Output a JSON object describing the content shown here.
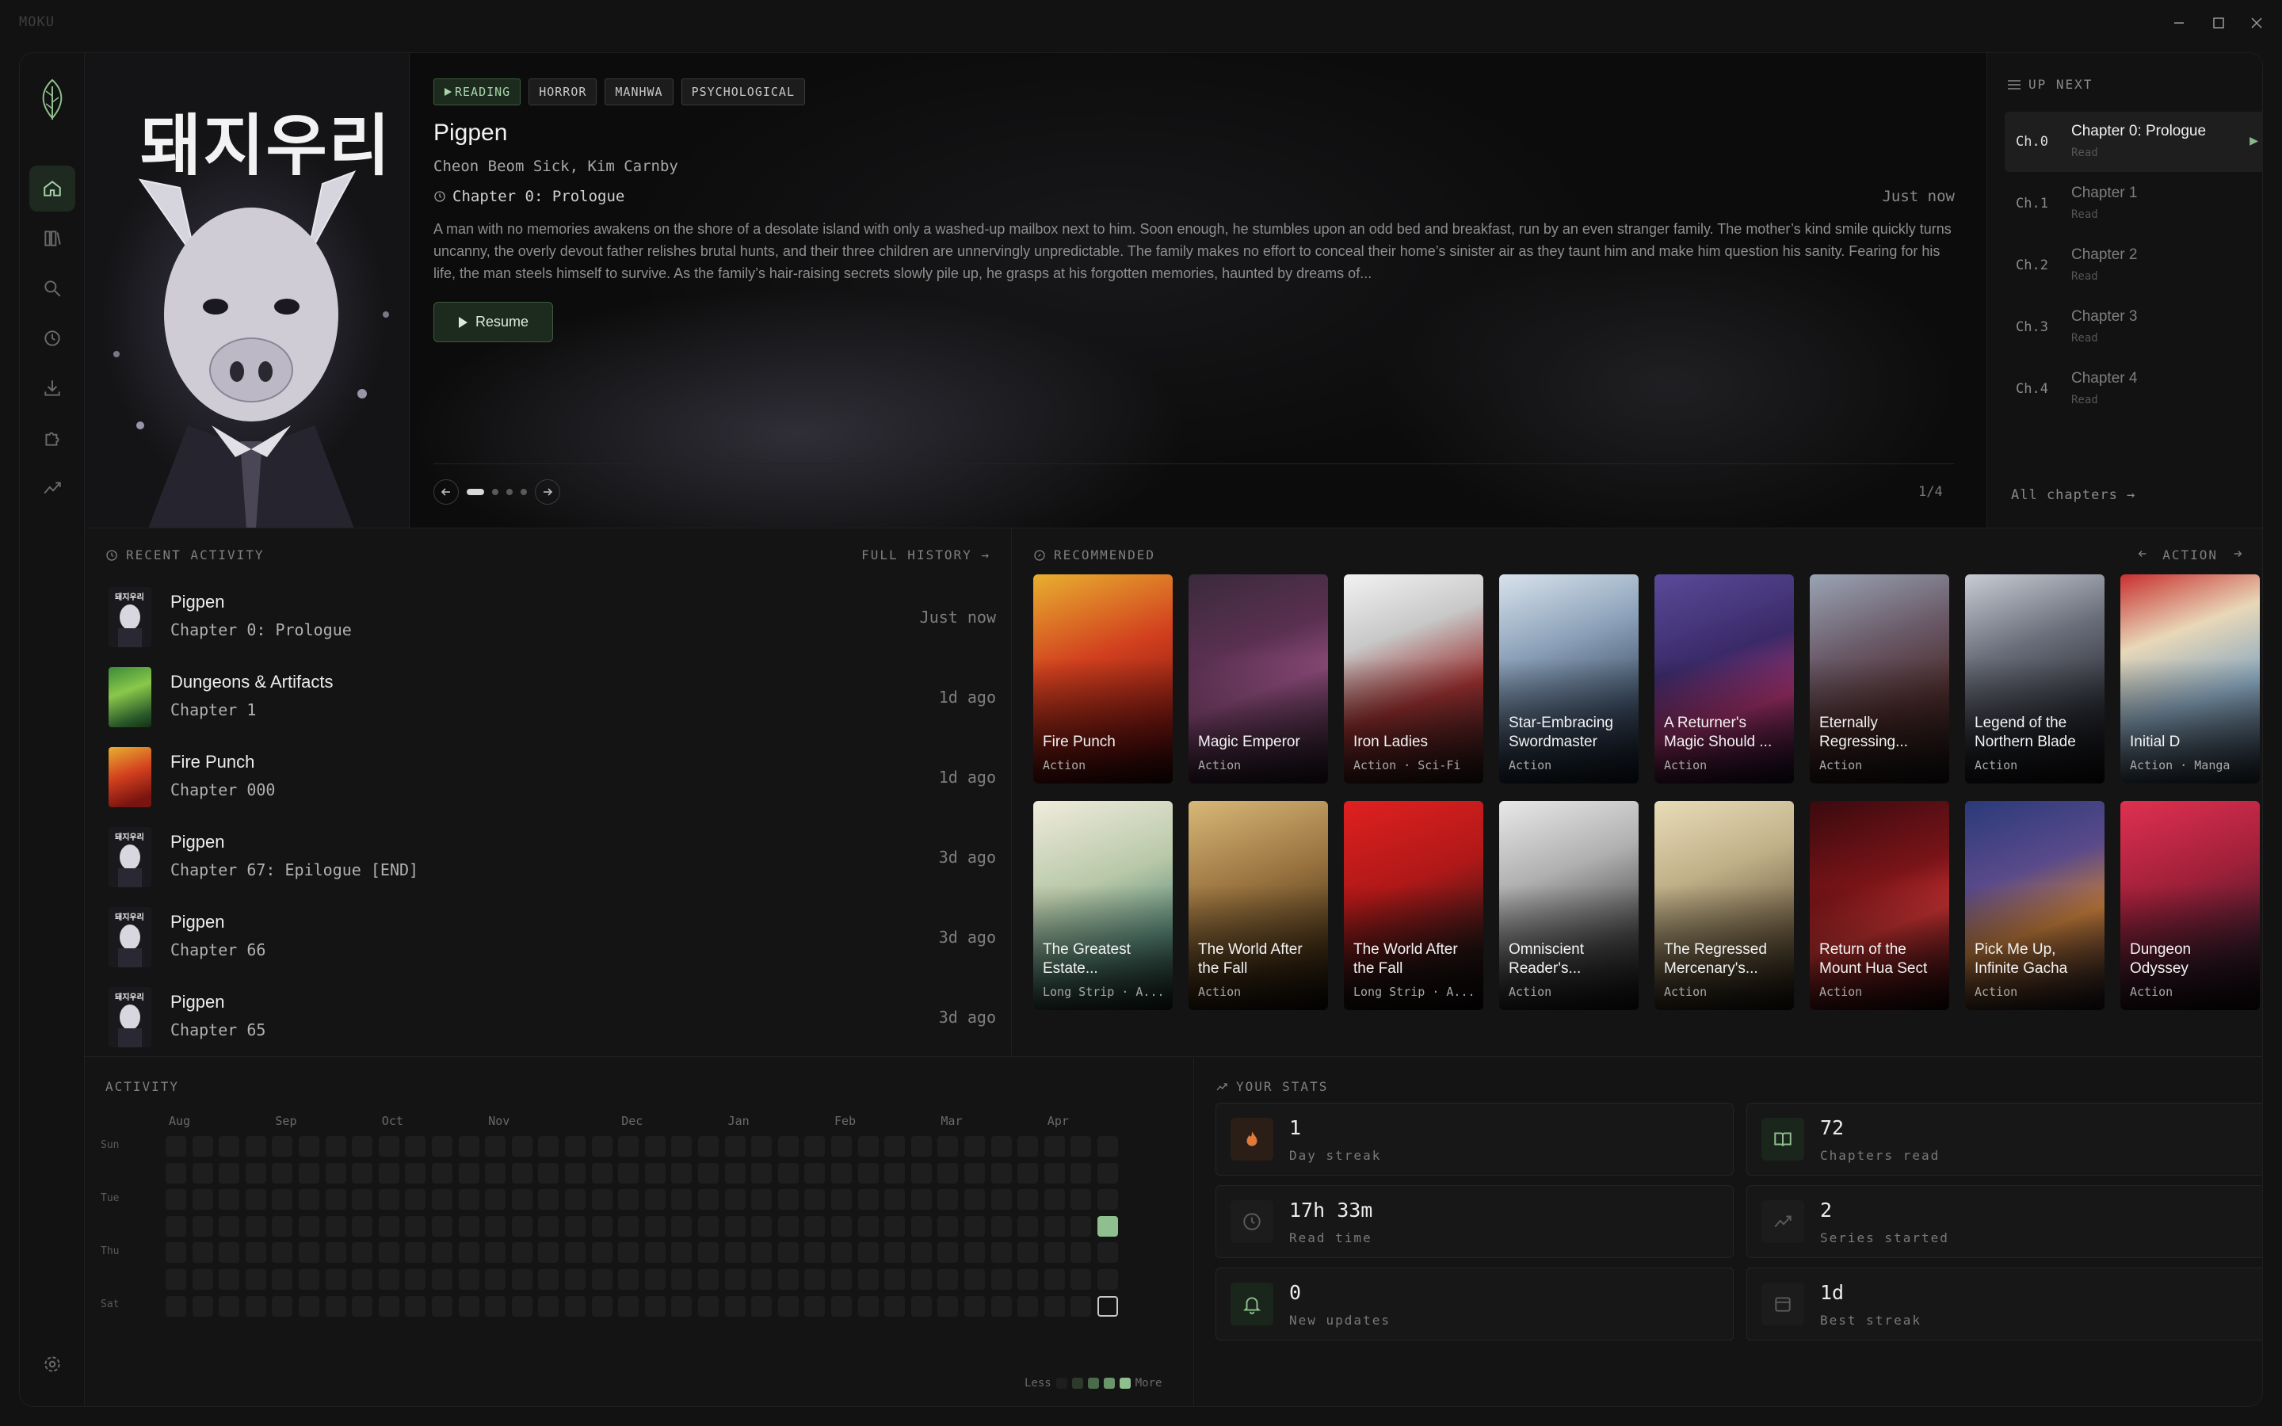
{
  "window": {
    "title": "MOKU"
  },
  "colors": {
    "accent": "#8fbf8f",
    "background": "#141414",
    "panel": "#121212"
  },
  "sidebar": {
    "items": [
      {
        "name": "home",
        "icon": "home-icon",
        "active": true
      },
      {
        "name": "library",
        "icon": "library-icon",
        "active": false
      },
      {
        "name": "search",
        "icon": "search-icon",
        "active": false
      },
      {
        "name": "history",
        "icon": "history-icon",
        "active": false
      },
      {
        "name": "downloads",
        "icon": "download-icon",
        "active": false
      },
      {
        "name": "extensions",
        "icon": "puzzle-icon",
        "active": false
      },
      {
        "name": "stats",
        "icon": "chart-icon",
        "active": false
      }
    ],
    "bottom": {
      "icon": "gear-icon"
    }
  },
  "hero": {
    "tags": [
      "READING",
      "HORROR",
      "MANHWA",
      "PSYCHOLOGICAL"
    ],
    "title": "Pigpen",
    "cover_text": "돼지우리",
    "authors": "Cheon Beom Sick, Kim Carnby",
    "chapter": "Chapter 0: Prologue",
    "timestamp": "Just now",
    "description": "A man with no memories awakens on the shore of a desolate island with only a washed-up mailbox next to him. Soon enough, he stumbles upon an odd bed and breakfast, run by an even stranger family. The mother’s kind smile quickly turns uncanny, the overly devout father relishes brutal hunts, and their three children are unnervingly unpredictable. The family makes no effort to conceal their home’s sinister air as they taunt him and make him question his sanity. Fearing for his life, the man steels himself to survive. As the family’s hair-raising secrets slowly pile up, he grasps at his forgotten memories, haunted by dreams of...",
    "resume_label": "Resume",
    "page": "1/4",
    "slides_total": 4,
    "slide_active": 1
  },
  "up_next": {
    "title": "UP NEXT",
    "items": [
      {
        "num": "Ch.0",
        "title": "Chapter 0: Prologue",
        "status": "Read",
        "active": true
      },
      {
        "num": "Ch.1",
        "title": "Chapter 1",
        "status": "Read",
        "active": false
      },
      {
        "num": "Ch.2",
        "title": "Chapter 2",
        "status": "Read",
        "active": false
      },
      {
        "num": "Ch.3",
        "title": "Chapter 3",
        "status": "Read",
        "active": false
      },
      {
        "num": "Ch.4",
        "title": "Chapter 4",
        "status": "Read",
        "active": false
      }
    ],
    "all_chapters": "All chapters →"
  },
  "recent": {
    "title": "RECENT ACTIVITY",
    "full_history": "FULL HISTORY →",
    "items": [
      {
        "title": "Pigpen",
        "chapter": "Chapter 0: Prologue",
        "ago": "Just now",
        "thumb": "pigpen"
      },
      {
        "title": "Dungeons & Artifacts",
        "chapter": "Chapter 1",
        "ago": "1d ago",
        "thumb": "dungeons"
      },
      {
        "title": "Fire Punch",
        "chapter": "Chapter 000",
        "ago": "1d ago",
        "thumb": "firepunch"
      },
      {
        "title": "Pigpen",
        "chapter": "Chapter 67: Epilogue [END]",
        "ago": "3d ago",
        "thumb": "pigpen"
      },
      {
        "title": "Pigpen",
        "chapter": "Chapter 66",
        "ago": "3d ago",
        "thumb": "pigpen"
      },
      {
        "title": "Pigpen",
        "chapter": "Chapter 65",
        "ago": "3d ago",
        "thumb": "pigpen"
      }
    ]
  },
  "recommended": {
    "title": "RECOMMENDED",
    "genre": "ACTION",
    "cards": [
      {
        "title": "Fire Punch",
        "genre": "Action",
        "bg": "linear-gradient(160deg,#e8b030 0%,#d2401e 40%,#7a1410 80%,#2a0808 100%)"
      },
      {
        "title": "Magic Emperor",
        "genre": "Action",
        "bg": "linear-gradient(160deg,#3a2a3c 0%,#5a3050 35%,#8a4a78 55%,#241a26 100%)"
      },
      {
        "title": "Iron Ladies",
        "genre": "Action · Sci-Fi",
        "bg": "linear-gradient(160deg,#f2f2f2 0%,#c8c8c8 30%,#9a3030 60%,#281818 100%)"
      },
      {
        "title": "Star-Embracing Swordmaster",
        "genre": "Action",
        "bg": "linear-gradient(160deg,#d8e2ec 0%,#8aa0b8 35%,#3a4a60 70%,#121a26 100%)"
      },
      {
        "title": "A Returner's Magic Should ...",
        "genre": "Action",
        "bg": "linear-gradient(160deg,#5a4a9a 0%,#3a2a68 40%,#a0306a 65%,#180f26 100%)"
      },
      {
        "title": "Eternally Regressing...",
        "genre": "Action",
        "bg": "linear-gradient(160deg,#9aa4b4 0%,#6a5a68 35%,#4a2a2a 65%,#1a1414 100%)"
      },
      {
        "title": "Legend of the Northern Blade",
        "genre": "Action",
        "bg": "linear-gradient(160deg,#c8ccd4 0%,#6a6e7a 35%,#2a2c34 70%,#0e0e12 100%)"
      },
      {
        "title": "Initial D",
        "genre": "Action · Manga",
        "bg": "linear-gradient(160deg,#c83030 0%,#e8d8b8 30%,#8aa8c0 60%,#2a3440 100%)"
      },
      {
        "title": "The Greatest Estate...",
        "genre": "Long Strip · A...",
        "bg": "linear-gradient(160deg,#f0ecdc 0%,#b8c8a8 40%,#5a8a7a 70%,#1a2a28 100%)"
      },
      {
        "title": "The World After the Fall",
        "genre": "Action",
        "bg": "linear-gradient(160deg,#d8b878 0%,#9a7440 40%,#4a3418 75%,#140e08 100%)"
      },
      {
        "title": "The World After the Fall",
        "genre": "Long Strip · A...",
        "bg": "linear-gradient(160deg,#e02020 0%,#b01818 40%,#281414 75%,#0c0808 100%)"
      },
      {
        "title": "Omniscient Reader's...",
        "genre": "Action",
        "bg": "linear-gradient(160deg,#e8e8e8 0%,#b0b0b0 35%,#4a4a4a 70%,#141414 100%)"
      },
      {
        "title": "The Regressed Mercenary's...",
        "genre": "Action",
        "bg": "linear-gradient(160deg,#e8dcb8 0%,#c0b088 35%,#6a5a40 70%,#1a160e 100%)"
      },
      {
        "title": "Return of the Mount Hua Sect",
        "genre": "Action",
        "bg": "linear-gradient(160deg,#3a0a0e 0%,#7a1418 40%,#c03030 60%,#1a0608 100%)"
      },
      {
        "title": "Pick Me Up, Infinite Gacha",
        "genre": "Action",
        "bg": "linear-gradient(160deg,#2a3a7a 0%,#5a4a8a 35%,#c07a3a 60%,#1a1420 100%)"
      },
      {
        "title": "Dungeon Odyssey",
        "genre": "Action",
        "bg": "linear-gradient(160deg,#e03050 0%,#a0203a 40%,#3a1a2a 75%,#120a10 100%)"
      }
    ]
  },
  "activity": {
    "title": "ACTIVITY",
    "months": [
      "Aug",
      "Sep",
      "Oct",
      "Nov",
      "Dec",
      "Jan",
      "Feb",
      "Mar",
      "Apr"
    ],
    "days": [
      "Sun",
      "Tue",
      "Thu",
      "Sat"
    ],
    "legend_less": "Less",
    "legend_more": "More"
  },
  "stats": {
    "title": "YOUR STATS",
    "items": [
      {
        "value": "1",
        "label": "Day streak",
        "icon": "flame-icon",
        "accent": "#e07a3a"
      },
      {
        "value": "72",
        "label": "Chapters read",
        "icon": "book-open-icon",
        "accent": "#8fbf8f"
      },
      {
        "value": "17h 33m",
        "label": "Read time",
        "icon": "clock-icon",
        "accent": "#5a5a5a"
      },
      {
        "value": "2",
        "label": "Series started",
        "icon": "trending-up-icon",
        "accent": "#5a5a5a"
      },
      {
        "value": "0",
        "label": "New updates",
        "icon": "bell-icon",
        "accent": "#8fbf8f"
      },
      {
        "value": "1d",
        "label": "Best streak",
        "icon": "calendar-icon",
        "accent": "#5a5a5a"
      }
    ]
  }
}
